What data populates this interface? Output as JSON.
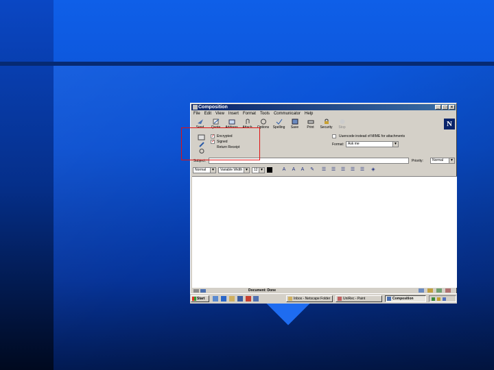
{
  "window": {
    "title": "Composition"
  },
  "menu": [
    "File",
    "Edit",
    "View",
    "Insert",
    "Format",
    "Tools",
    "Communicator",
    "Help"
  ],
  "toolbar": [
    {
      "label": "Send",
      "icon": "send-icon"
    },
    {
      "label": "Quote",
      "icon": "quote-icon"
    },
    {
      "label": "Address",
      "icon": "address-icon"
    },
    {
      "label": "Attach",
      "icon": "attach-icon"
    },
    {
      "label": "Options",
      "icon": "options-icon"
    },
    {
      "label": "Spelling",
      "icon": "spelling-icon"
    },
    {
      "label": "Save",
      "icon": "save-icon"
    },
    {
      "label": "Print",
      "icon": "print-icon"
    },
    {
      "label": "Security",
      "icon": "security-icon"
    },
    {
      "label": "Stop",
      "icon": "stop-icon",
      "disabled": true
    }
  ],
  "options": {
    "encrypted_label": "Encrypted",
    "signed_label": "Signed",
    "return_receipt_label": "Return Receipt",
    "uuencode_label": "Uuencode instead of MIME for attachments",
    "format_label": "Format:",
    "format_value": "Ask me"
  },
  "subject": {
    "label": "Subject:",
    "value": "",
    "priority_label": "Priority:",
    "priority_value": "Normal"
  },
  "format_bar": {
    "paragraph_style": "Normal",
    "font": "Variable Width",
    "size": "12"
  },
  "status": {
    "text": "Document: Done"
  },
  "taskbar": {
    "start_label": "Start",
    "tasks": [
      {
        "label": "Inbox - Netscape Folder",
        "active": false
      },
      {
        "label": "UniRec - Paint",
        "active": false
      },
      {
        "label": "Composition",
        "active": true
      }
    ]
  }
}
